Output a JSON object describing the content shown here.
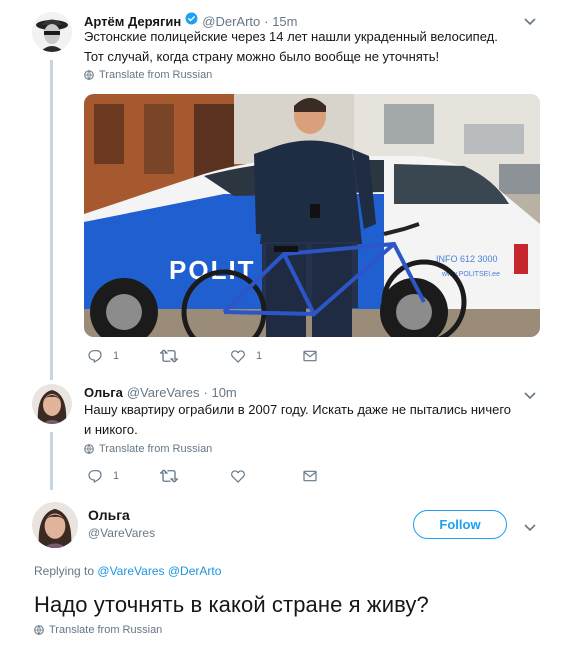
{
  "tweet1": {
    "author_name": "Артём Дерягин",
    "author_handle": "@DerArto",
    "time": "· 15m",
    "text_line1": "Эстонские полицейские через 14 лет нашли украденный велосипед.",
    "text_line2": "Тот случай, когда страну можно было вообще не уточнять!",
    "translate": "Translate from Russian",
    "photo_text_polit": "POLIT",
    "photo_text_info": "INFO 612 3000",
    "photo_text_web": "www.POLITSEI.ee",
    "reply_count": "1",
    "like_count": "1"
  },
  "tweet2": {
    "author_name": "Ольга",
    "author_handle": "@VareVares",
    "time": "· 10m",
    "text_line1": "Нашу квартиру ограбили в 2007 году. Искать даже не пытались ничего",
    "text_line2": "и никого.",
    "translate": "Translate from Russian",
    "reply_count": "1"
  },
  "main_tweet": {
    "author_name": "Ольга",
    "author_handle": "@VareVares",
    "follow_label": "Follow",
    "replying_prefix": "Replying to",
    "replying_to_1": "@VareVares",
    "replying_to_2": "@DerArto",
    "text": "Надо уточнять в какой стране я живу?",
    "translate": "Translate from Russian"
  },
  "colors": {
    "twitter_blue": "#1da1f2",
    "link_blue": "#1b95e0",
    "gray": "#657786",
    "thread_line": "#c4d6e3",
    "verified": "#1da1f2"
  },
  "icons": [
    "globe-icon",
    "reply-icon",
    "retweet-icon",
    "like-icon",
    "dm-icon",
    "chevron-down-icon",
    "verified-icon"
  ]
}
